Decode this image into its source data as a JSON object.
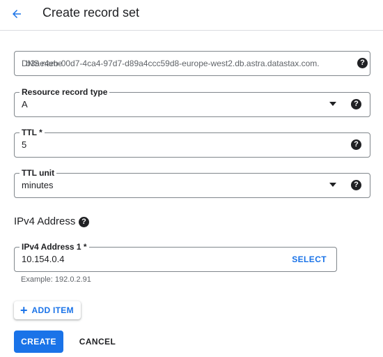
{
  "header": {
    "title": "Create record set",
    "back_icon": "arrow-back-icon"
  },
  "dns_name": {
    "label": "DNS name",
    "value": "b3ae4eb-00d7-4ca4-97d7-d89a4ccc59d8-europe-west2.db.astra.datastax.com."
  },
  "record_type": {
    "label": "Resource record type",
    "value": "A"
  },
  "ttl": {
    "label": "TTL *",
    "value": "5"
  },
  "ttl_unit": {
    "label": "TTL unit",
    "value": "minutes"
  },
  "ipv4_section": {
    "title": "IPv4 Address",
    "field_label": "IPv4 Address 1 *",
    "value": "10.154.0.4",
    "select_label": "SELECT",
    "hint": "Example: 192.0.2.91"
  },
  "actions": {
    "add_item": "ADD ITEM",
    "create": "CREATE",
    "cancel": "CANCEL"
  },
  "colors": {
    "accent": "#1a73e8",
    "text": "#202124",
    "border": "#80868b"
  }
}
